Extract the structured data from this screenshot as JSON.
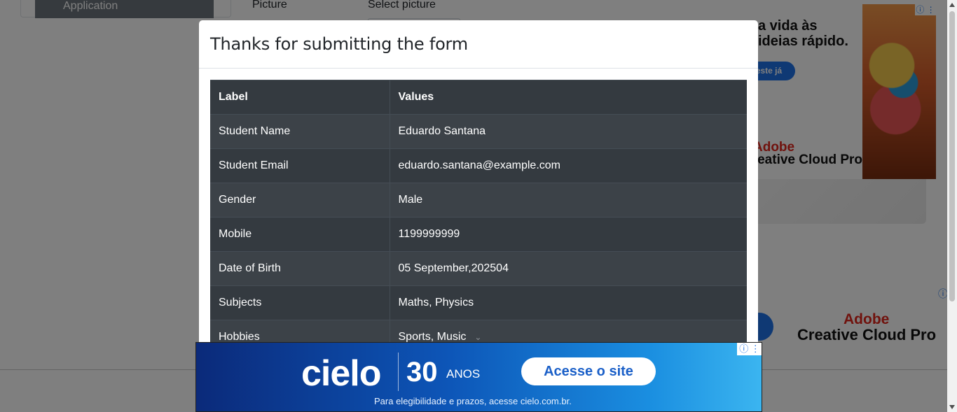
{
  "background": {
    "sidebar_item": "Application",
    "picture_label": "Picture",
    "select_picture": "Select picture"
  },
  "modal": {
    "title": "Thanks for submitting the form",
    "table": {
      "headers": [
        "Label",
        "Values"
      ],
      "rows": [
        [
          "Student Name",
          "Eduardo Santana"
        ],
        [
          "Student Email",
          "eduardo.santana@example.com"
        ],
        [
          "Gender",
          "Male"
        ],
        [
          "Mobile",
          "1199999999"
        ],
        [
          "Date of Birth",
          "05 September,202504"
        ],
        [
          "Subjects",
          "Maths, Physics"
        ],
        [
          "Hobbies",
          "Sports, Music"
        ]
      ]
    }
  },
  "ad_right_top": {
    "headline": "a vida às\nideias rápido.",
    "button": "este já",
    "brand": "Adobe",
    "product": "Creative Cloud Pro",
    "info": "ⓘ ⋮"
  },
  "ad_right_mid": {
    "brand": "Adobe",
    "product": "Creative Cloud Pro",
    "info": "ⓘ"
  },
  "ad_bottom": {
    "logo": "cielo",
    "years": "30",
    "anos": "ANOS",
    "button": "Acesse o site",
    "fine_print": "Para elegibilidade e prazos, acesse cielo.com.br.",
    "info": "ⓘ ⋮"
  },
  "colors": {
    "table_bg": "#343a40",
    "overlay": "rgba(0,0,0,0.5)",
    "ad_blue": "#1e73e8"
  }
}
